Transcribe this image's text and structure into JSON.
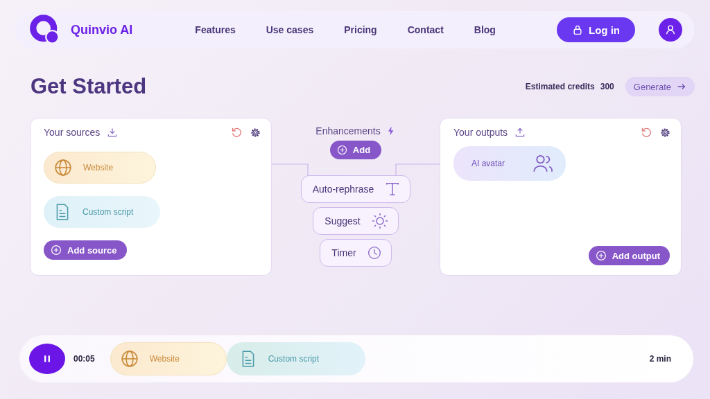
{
  "header": {
    "brand": "Quinvio AI",
    "nav": [
      "Features",
      "Use cases",
      "Pricing",
      "Contact",
      "Blog"
    ],
    "login": "Log in"
  },
  "page": {
    "title": "Get Started",
    "credits_label": "Estimated credits",
    "credits": "300",
    "generate": "Generate"
  },
  "sources": {
    "title": "Your sources",
    "items": [
      {
        "kind": "website",
        "label": "Website"
      },
      {
        "kind": "script",
        "label": "Custom script"
      }
    ],
    "add": "Add source"
  },
  "enhancements": {
    "title": "Enhancements",
    "add": "Add",
    "items": [
      {
        "kind": "text",
        "label": "Auto-rephrase"
      },
      {
        "kind": "sun",
        "label": "Suggest"
      },
      {
        "kind": "clock",
        "label": "Timer"
      }
    ]
  },
  "outputs": {
    "title": "Your outputs",
    "items": [
      {
        "kind": "avatar",
        "label": "AI avatar"
      }
    ],
    "add": "Add output"
  },
  "player": {
    "time": "00:05",
    "tracks": [
      {
        "kind": "website",
        "label": "Website"
      },
      {
        "kind": "script",
        "label": "Custom script"
      }
    ],
    "duration": "2 min"
  }
}
